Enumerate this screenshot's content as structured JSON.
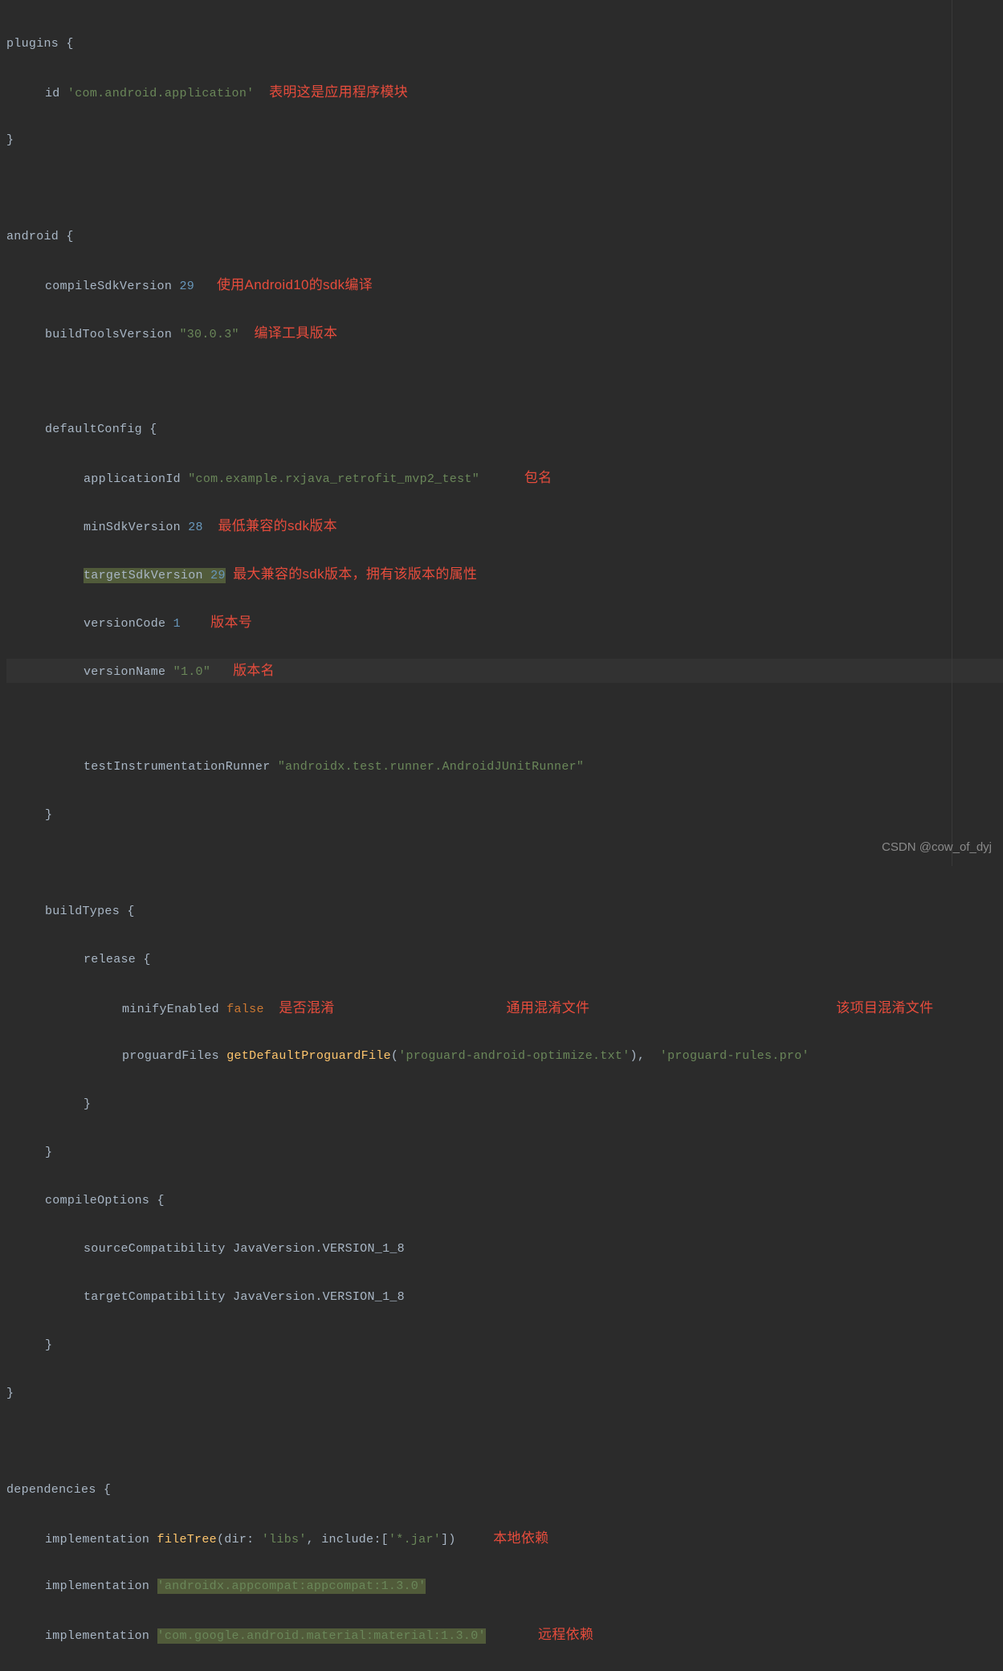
{
  "code": {
    "plugins": {
      "open": "plugins {",
      "id_kw": "id",
      "id_val": "'com.android.application'",
      "close": "}"
    },
    "android": {
      "open": "android {",
      "compileSdk_kw": "compileSdkVersion",
      "compileSdk_val": "29",
      "buildTools_kw": "buildToolsVersion",
      "buildTools_val": "\"30.0.3\"",
      "defaultConfig_open": "defaultConfig {",
      "appId_kw": "applicationId",
      "appId_val": "\"com.example.rxjava_retrofit_mvp2_test\"",
      "minSdk_kw": "minSdkVersion",
      "minSdk_val": "28",
      "targetSdk_kw": "targetSdkVersion",
      "targetSdk_val": "29",
      "versionCode_kw": "versionCode",
      "versionCode_val": "1",
      "versionName_kw": "versionName",
      "versionName_val": "\"1.0\"",
      "testRunner_kw": "testInstrumentationRunner",
      "testRunner_val": "\"androidx.test.runner.AndroidJUnitRunner\"",
      "defaultConfig_close": "}",
      "buildTypes_open": "buildTypes {",
      "release_open": "release {",
      "minify_kw": "minifyEnabled",
      "minify_val": "false",
      "proguard_kw": "proguardFiles",
      "proguard_method": "getDefaultProguardFile",
      "proguard_arg1": "'proguard-android-optimize.txt'",
      "proguard_sep": "),  ",
      "proguard_arg2": "'proguard-rules.pro'",
      "release_close": "}",
      "buildTypes_close": "}",
      "compileOptions_open": "compileOptions {",
      "sourceCompat_kw": "sourceCompatibility",
      "sourceCompat_val": "JavaVersion.VERSION_1_8",
      "targetCompat_kw": "targetCompatibility",
      "targetCompat_val": "JavaVersion.VERSION_1_8",
      "compileOptions_close": "}",
      "close": "}"
    },
    "deps": {
      "open": "dependencies {",
      "impl_kw": "implementation",
      "fileTree_method": "fileTree",
      "fileTree_open": "(",
      "dir_label": "dir:",
      "dir_val": "'libs'",
      "comma": ", ",
      "include_label": "include:",
      "include_open": "[",
      "include_val": "'*.jar'",
      "include_close": "])",
      "appcompat": "'androidx.appcompat:appcompat:1.3.0'",
      "material": "'com.google.android.material:material:1.3.0'"
    }
  },
  "annotations": {
    "app_module": "表明这是应用程序模块",
    "sdk_compile": "使用Android10的sdk编译",
    "build_tools_ver": "编译工具版本",
    "pkg_name": "包名",
    "min_sdk": "最低兼容的sdk版本",
    "target_sdk": "最大兼容的sdk版本，拥有该版本的属性",
    "ver_code": "版本号",
    "ver_name": "版本名",
    "minify": "是否混淆",
    "proguard_common": "通用混淆文件",
    "proguard_project": "该项目混淆文件",
    "local_dep": "本地依赖",
    "remote_dep": "远程依赖"
  },
  "watermark": "CSDN @cow_of_dyj"
}
